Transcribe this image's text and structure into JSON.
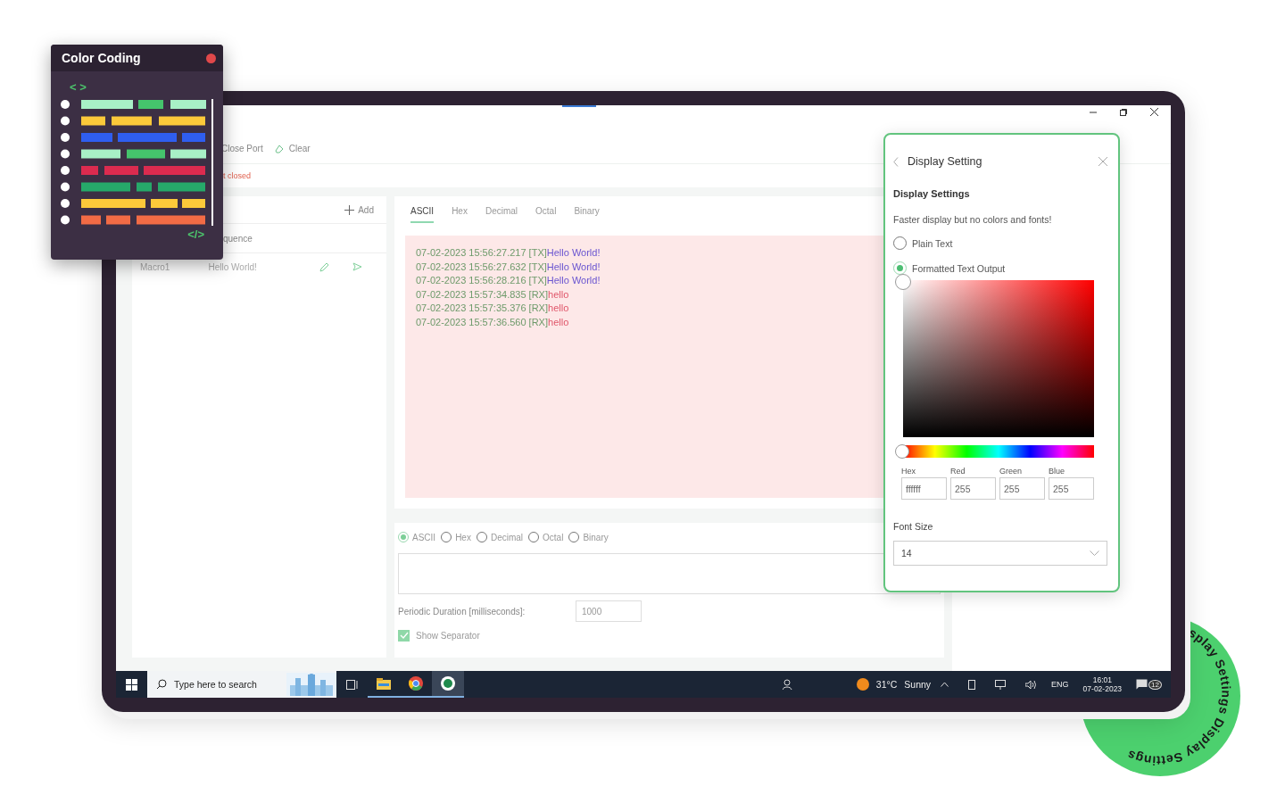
{
  "card": {
    "title": "Color Coding",
    "open_tag": "< >",
    "close_tag": "</>"
  },
  "toolbar": [
    {
      "label": "Close Port"
    },
    {
      "label": "Clear"
    }
  ],
  "status": "t closed",
  "macros": {
    "add": "Add",
    "column": "quence",
    "rows": [
      {
        "name": "Macro1",
        "value": "Hello World!"
      }
    ]
  },
  "output": {
    "tabs": [
      {
        "label": "ASCII",
        "selected": true
      },
      {
        "label": "Hex",
        "selected": false
      },
      {
        "label": "Decimal",
        "selected": false
      },
      {
        "label": "Octal",
        "selected": false
      },
      {
        "label": "Binary",
        "selected": false
      }
    ],
    "lines": [
      {
        "time": "07-02-2023 15:56:27.217",
        "dir": "[TX]",
        "text": "Hello World!",
        "kind": "tx"
      },
      {
        "time": "07-02-2023 15:56:27.632",
        "dir": "[TX]",
        "text": "Hello World!",
        "kind": "tx"
      },
      {
        "time": "07-02-2023 15:56:28.216",
        "dir": "[TX]",
        "text": "Hello World!",
        "kind": "tx"
      },
      {
        "time": "07-02-2023 15:57:34.835",
        "dir": "[RX]",
        "text": "hello",
        "kind": "rx"
      },
      {
        "time": "07-02-2023 15:57:35.376",
        "dir": "[RX]",
        "text": "hello",
        "kind": "rx"
      },
      {
        "time": "07-02-2023 15:57:36.560",
        "dir": "[RX]",
        "text": "hello",
        "kind": "rx"
      }
    ]
  },
  "input": {
    "formats": [
      {
        "label": "ASCII",
        "selected": true
      },
      {
        "label": "Hex",
        "selected": false
      },
      {
        "label": "Decimal",
        "selected": false
      },
      {
        "label": "Octal",
        "selected": false
      },
      {
        "label": "Binary",
        "selected": false
      }
    ],
    "period_label": "Periodic Duration [milliseconds]:",
    "period_value": "1000",
    "separator": {
      "label": "Show Separator",
      "checked": true
    }
  },
  "display_panel": {
    "title": "Display Setting",
    "heading": "Display Settings",
    "note": "Faster display but no colors and fonts!",
    "modes": [
      {
        "label": "Plain Text",
        "selected": false
      },
      {
        "label": "Formatted Text Output",
        "selected": true
      }
    ],
    "hue": {
      "level": 0
    },
    "fields": [
      {
        "label": "Hex",
        "value": "ffffff"
      },
      {
        "label": "Red",
        "value": "255"
      },
      {
        "label": "Green",
        "value": "255"
      },
      {
        "label": "Blue",
        "value": "255"
      }
    ],
    "font_size": {
      "label": "Font Size",
      "value": "14"
    }
  },
  "taskbar": {
    "search_placeholder": "Type here to search",
    "temp": "31°C",
    "condition": "Sunny",
    "lang": "ENG",
    "time": "16:01",
    "date": "07-02-2023",
    "notifications": "12"
  },
  "badge": {
    "text": "splay Settings Display Settings"
  }
}
